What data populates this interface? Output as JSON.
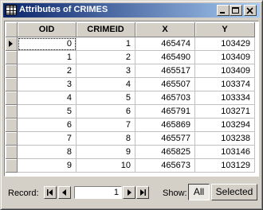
{
  "window": {
    "title": "Attributes of CRIMES"
  },
  "table": {
    "columns": [
      "OID",
      "CRIMEID",
      "X",
      "Y"
    ],
    "rows": [
      [
        "0",
        "1",
        "465474",
        "103429"
      ],
      [
        "1",
        "2",
        "465490",
        "103409"
      ],
      [
        "2",
        "3",
        "465517",
        "103409"
      ],
      [
        "3",
        "4",
        "465507",
        "103374"
      ],
      [
        "4",
        "5",
        "465703",
        "103334"
      ],
      [
        "5",
        "6",
        "465791",
        "103271"
      ],
      [
        "6",
        "7",
        "465869",
        "103294"
      ],
      [
        "7",
        "8",
        "465577",
        "103238"
      ],
      [
        "8",
        "9",
        "465825",
        "103146"
      ],
      [
        "9",
        "10",
        "465673",
        "103129"
      ]
    ]
  },
  "footer": {
    "record_label": "Record:",
    "record_value": "1",
    "show_label": "Show:",
    "all_label": "All",
    "selected_label": "Selected"
  },
  "icons": [
    "table-icon",
    "minimize-icon",
    "maximize-icon",
    "close-icon",
    "first-record-icon",
    "previous-record-icon",
    "next-record-icon",
    "last-record-icon",
    "current-row-arrow-icon"
  ],
  "colors": {
    "titlebar_start": "#0a246a",
    "titlebar_end": "#a6caf0",
    "face": "#d4d0c8"
  }
}
